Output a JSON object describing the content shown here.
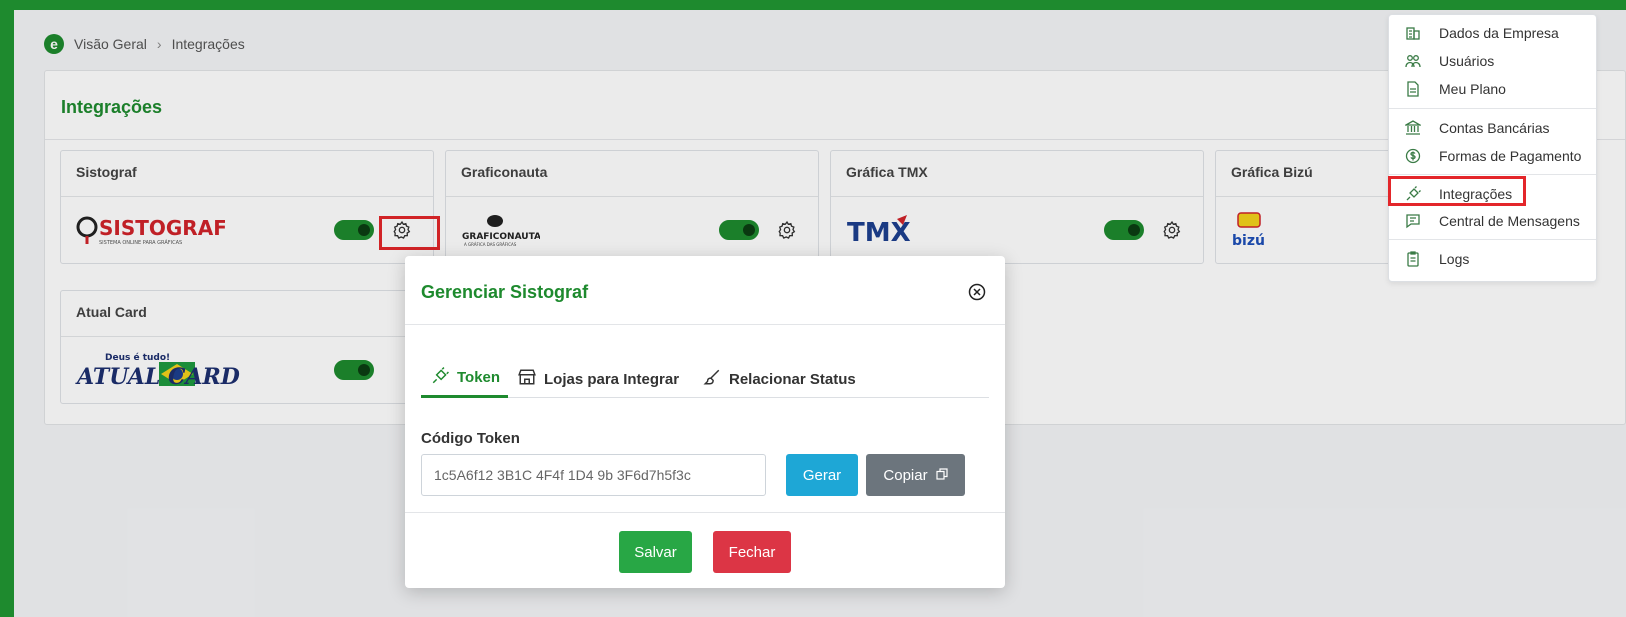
{
  "breadcrumb": {
    "logo_letter": "e",
    "home": "Visão Geral",
    "current": "Integrações"
  },
  "page": {
    "title": "Integrações"
  },
  "cards": [
    {
      "name": "Sistograf",
      "logo_text": "SISTOGRAF",
      "logo_sub": "SISTEMA ONLINE PARA GRÁFICAS",
      "enabled": true
    },
    {
      "name": "Graficonauta",
      "logo_text": "GRAFICONAUTA",
      "logo_sub": "A GRÁFICA DAS GRÁFICAS",
      "enabled": true
    },
    {
      "name": "Gráfica TMX",
      "logo_text": "TMX",
      "enabled": true
    },
    {
      "name": "Gráfica Bizú",
      "logo_text": "bizú",
      "enabled": true
    },
    {
      "name": "Atual Card",
      "logo_text": "ATUAL CARD",
      "logo_sub": "Deus é tudo!",
      "enabled": true
    }
  ],
  "dropdown": {
    "items": [
      {
        "label": "Dados da Empresa",
        "icon": "building-icon"
      },
      {
        "label": "Usuários",
        "icon": "users-icon"
      },
      {
        "label": "Meu Plano",
        "icon": "document-icon"
      },
      {
        "label": "Contas Bancárias",
        "icon": "bank-icon"
      },
      {
        "label": "Formas de Pagamento",
        "icon": "dollar-circle-icon"
      },
      {
        "label": "Integrações",
        "icon": "plug-icon"
      },
      {
        "label": "Central de Mensagens",
        "icon": "message-icon"
      },
      {
        "label": "Logs",
        "icon": "clipboard-icon"
      }
    ]
  },
  "modal": {
    "title": "Gerenciar Sistograf",
    "tabs": [
      {
        "label": "Token",
        "icon": "plug-icon"
      },
      {
        "label": "Lojas para Integrar",
        "icon": "store-icon"
      },
      {
        "label": "Relacionar Status",
        "icon": "brush-icon"
      }
    ],
    "token_label": "Código Token",
    "token_value": "1c5A6f12 3B1C 4F4f 1D4 9b 3F6d7h5f3c",
    "generate_label": "Gerar",
    "copy_label": "Copiar",
    "save_label": "Salvar",
    "close_label": "Fechar"
  },
  "colors": {
    "brand": "#1e8a2e",
    "highlight": "#e3262a",
    "info": "#1ea7d6",
    "secondary": "#6c757d",
    "success": "#28a745",
    "danger": "#dc3545"
  }
}
